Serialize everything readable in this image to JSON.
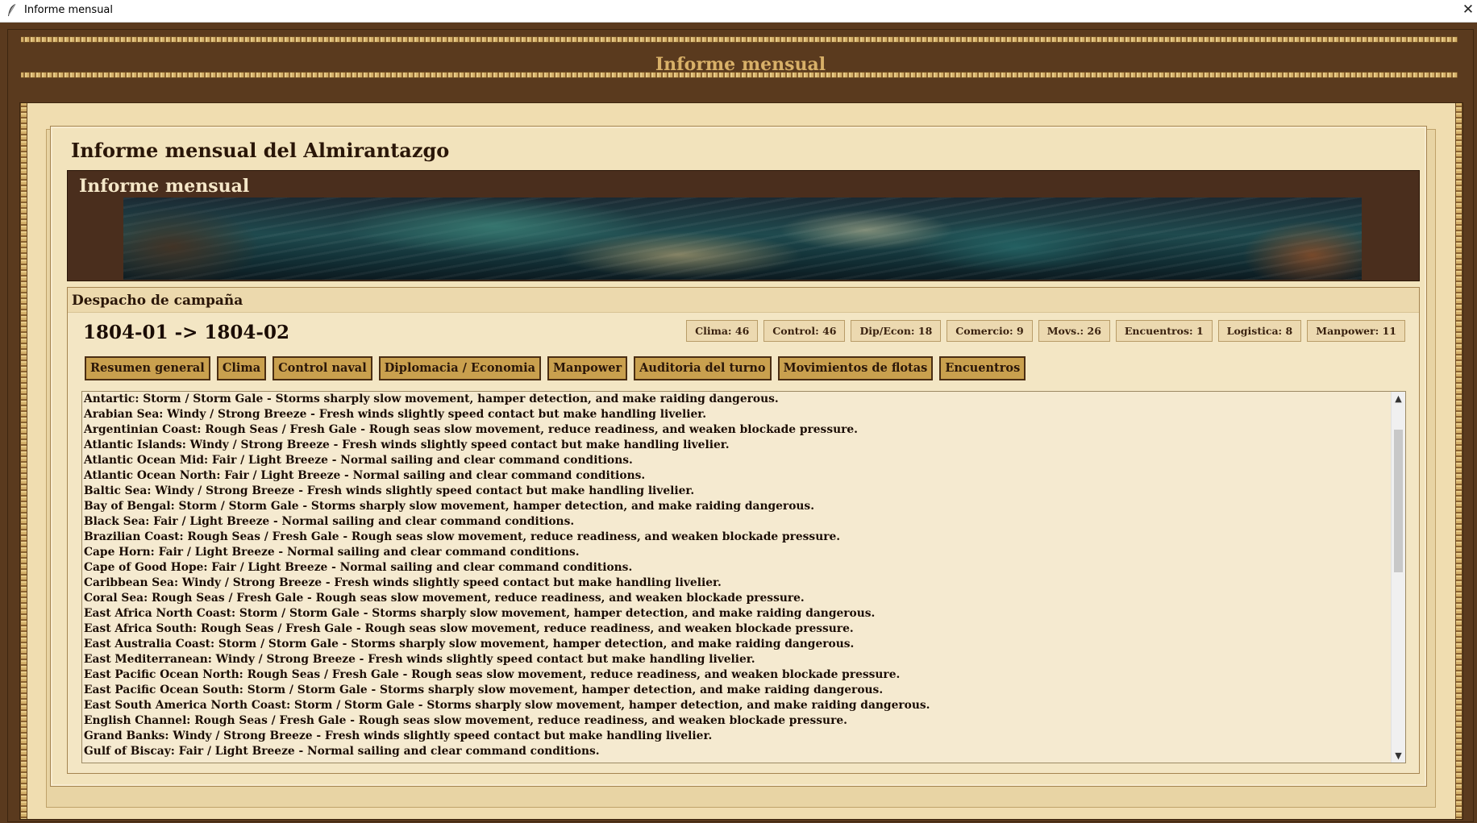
{
  "window": {
    "title": "Informe mensual",
    "close_symbol": "✕"
  },
  "header": {
    "title": "Informe mensual"
  },
  "main": {
    "title": "Informe mensual del Almirantazgo",
    "banner_title": "Informe mensual"
  },
  "dispatch": {
    "title": "Despacho de campaña",
    "period": "1804-01 -> 1804-02",
    "chips": [
      "Clima: 46",
      "Control: 46",
      "Dip/Econ: 18",
      "Comercio: 9",
      "Movs.: 26",
      "Encuentros: 1",
      "Logistica: 8",
      "Manpower: 11"
    ],
    "tabs": [
      "Resumen general",
      "Clima",
      "Control naval",
      "Diplomacia / Economia",
      "Manpower",
      "Auditoria del turno",
      "Movimientos de flotas",
      "Encuentros"
    ],
    "lines": [
      "Antartic: Storm / Storm Gale - Storms sharply slow movement, hamper detection, and make raiding dangerous.",
      "Arabian Sea: Windy / Strong Breeze - Fresh winds slightly speed contact but make handling livelier.",
      "Argentinian Coast: Rough Seas / Fresh Gale - Rough seas slow movement, reduce readiness, and weaken blockade pressure.",
      "Atlantic Islands: Windy / Strong Breeze - Fresh winds slightly speed contact but make handling livelier.",
      "Atlantic Ocean Mid: Fair / Light Breeze - Normal sailing and clear command conditions.",
      "Atlantic Ocean North: Fair / Light Breeze - Normal sailing and clear command conditions.",
      "Baltic Sea: Windy / Strong Breeze - Fresh winds slightly speed contact but make handling livelier.",
      "Bay of Bengal: Storm / Storm Gale - Storms sharply slow movement, hamper detection, and make raiding dangerous.",
      "Black Sea: Fair / Light Breeze - Normal sailing and clear command conditions.",
      "Brazilian Coast: Rough Seas / Fresh Gale - Rough seas slow movement, reduce readiness, and weaken blockade pressure.",
      "Cape Horn: Fair / Light Breeze - Normal sailing and clear command conditions.",
      "Cape of Good Hope: Fair / Light Breeze - Normal sailing and clear command conditions.",
      "Caribbean Sea: Windy / Strong Breeze - Fresh winds slightly speed contact but make handling livelier.",
      "Coral Sea: Rough Seas / Fresh Gale - Rough seas slow movement, reduce readiness, and weaken blockade pressure.",
      "East Africa North Coast: Storm / Storm Gale - Storms sharply slow movement, hamper detection, and make raiding dangerous.",
      "East Africa South: Rough Seas / Fresh Gale - Rough seas slow movement, reduce readiness, and weaken blockade pressure.",
      "East Australia Coast: Storm / Storm Gale - Storms sharply slow movement, hamper detection, and make raiding dangerous.",
      "East Mediterranean: Windy / Strong Breeze - Fresh winds slightly speed contact but make handling livelier.",
      "East Pacific Ocean North: Rough Seas / Fresh Gale - Rough seas slow movement, reduce readiness, and weaken blockade pressure.",
      "East Pacific Ocean South: Storm / Storm Gale - Storms sharply slow movement, hamper detection, and make raiding dangerous.",
      "East South America North Coast: Storm / Storm Gale - Storms sharply slow movement, hamper detection, and make raiding dangerous.",
      "English Channel: Rough Seas / Fresh Gale - Rough seas slow movement, reduce readiness, and weaken blockade pressure.",
      "Grand Banks: Windy / Strong Breeze - Fresh winds slightly speed contact but make handling livelier.",
      "Gulf of Biscay: Fair / Light Breeze - Normal sailing and clear command conditions."
    ]
  },
  "scrollbar": {
    "up_symbol": "▲",
    "down_symbol": "▼"
  },
  "colors": {
    "frame_brown": "#5a3a1e",
    "title_gold": "#d8b068",
    "parchment": "#f2e3bc",
    "tab_gold": "#c9a04e"
  }
}
